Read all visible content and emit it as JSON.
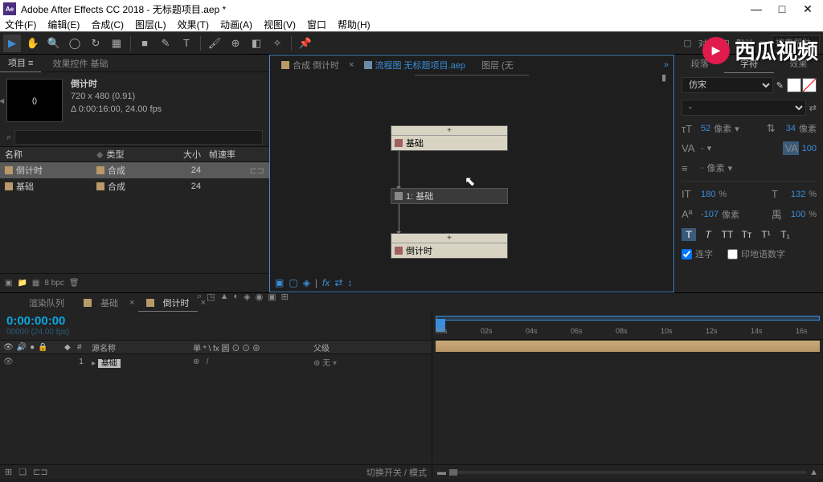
{
  "titlebar": {
    "title": "Adobe After Effects CC 2018 - 无标题项目.aep *",
    "app": "Ae"
  },
  "winctl": {
    "min": "—",
    "max": "□",
    "close": "✕"
  },
  "menubar": [
    "文件(F)",
    "编辑(E)",
    "合成(C)",
    "图层(L)",
    "效果(T)",
    "动画(A)",
    "视图(V)",
    "窗口",
    "帮助(H)"
  ],
  "toolbar": {
    "align": "对齐",
    "preset": "默认",
    "search_ph": "搜索帮助"
  },
  "project": {
    "tab_project": "项目 ≡",
    "tab_effects": "效果控件 基础",
    "name": "倒计时",
    "res": "720 x 480 (0.91)",
    "dur": "Δ 0:00:16:00, 24.00 fps",
    "search_icon": "⌕",
    "headers": {
      "name": "名称",
      "type": "类型",
      "size": "大小",
      "fps": "帧速率"
    },
    "rows": [
      {
        "name": "倒计时",
        "type": "合成",
        "fps": "24",
        "sel": true
      },
      {
        "name": "基础",
        "type": "合成",
        "fps": "24",
        "sel": false
      }
    ],
    "footer": {
      "bpc": "8 bpc"
    }
  },
  "center": {
    "tab_comp": "合成 倒计时",
    "tab_flow": "流程图 无标题项目.aep",
    "tab_layer": "图层 (无",
    "x": "×",
    "nodes": {
      "top": "基础",
      "mid": "1: 基础",
      "bot": "倒计时",
      "plus": "+"
    }
  },
  "char": {
    "tab_drop": "段落",
    "tab_char": "字符",
    "tab_fx": "效果",
    "font": "仿宋",
    "style": "-",
    "size": "52",
    "size_u": "像素",
    "leading": "34",
    "leading_u": "像素",
    "va_auto": "-",
    "va_val": "100",
    "stroke": "-",
    "stroke_u": "像素",
    "hscale": "180",
    "pct": "%",
    "vscale": "132",
    "baseline": "-107",
    "baseline_u": "像素",
    "tsume": "100",
    "chk1": "连字",
    "chk2": "印地语数字"
  },
  "timeline": {
    "tab_render": "渲染队列",
    "tab_base": "基础",
    "tab_timer": "倒计时",
    "x": "×",
    "tc": "0:00:00:00",
    "fps": "00000 (24.00 fps)",
    "head": {
      "num": "#",
      "src": "源名称",
      "switches": "单 * \\ fx 圆 ⊙ ⊙ ⊕",
      "parent": "父级"
    },
    "layer": {
      "num": "1",
      "name": "基础",
      "parent": "无"
    },
    "ticks": [
      "00s",
      "02s",
      "04s",
      "06s",
      "08s",
      "10s",
      "12s",
      "14s",
      "16s"
    ],
    "switch_label": "切换开关 / 模式"
  },
  "watermark": "西瓜视频"
}
